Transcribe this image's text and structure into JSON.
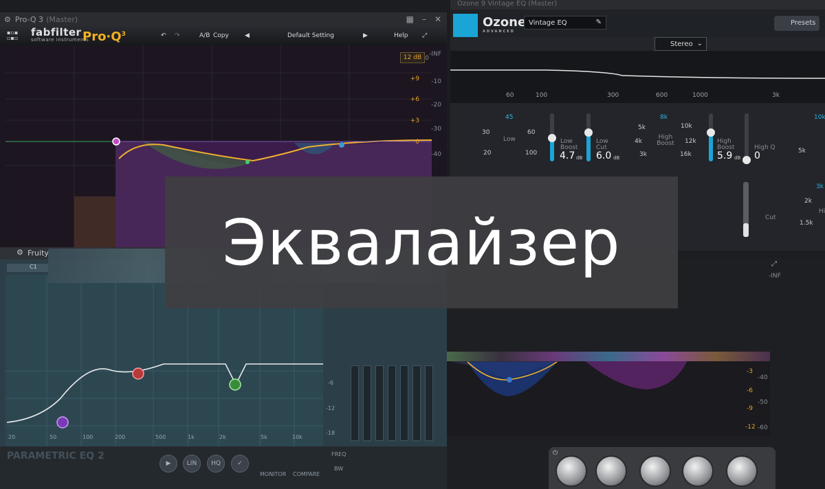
{
  "banner": {
    "title": "Эквалайзер"
  },
  "proq": {
    "window_title": "Pro-Q 3",
    "window_mode": "(Master)",
    "brand": "fabfilter",
    "brand_sub": "software instruments",
    "product": "Pro·Q",
    "ab": "A/B",
    "copy": "Copy",
    "preset": "Default Setting",
    "help": "Help",
    "range": "12 dB",
    "gain_ticks": [
      "+9",
      "+6",
      "+3",
      "0"
    ],
    "db_ticks": [
      "-INF",
      "0",
      "-10",
      "-20",
      "-30",
      "-40"
    ]
  },
  "ozone": {
    "window_title": "Ozone 9 Vintage EQ",
    "window_mode": "(Master)",
    "logo": "Ozone",
    "logo_sub": "ADVANCED",
    "preset": "Vintage EQ",
    "presets_button": "Presets",
    "stereo": "Stereo",
    "freq_labels": [
      "60",
      "100",
      "300",
      "600",
      "1000",
      "3k"
    ],
    "low_knob": {
      "label": "Low",
      "value": "45",
      "ticks": [
        "30",
        "60",
        "20",
        "100"
      ]
    },
    "low_boost": {
      "label": "Low Boost",
      "value": "4.7",
      "unit": "dB"
    },
    "low_cut": {
      "label": "Low Cut",
      "value": "6.0",
      "unit": "dB"
    },
    "high_knob": {
      "label": "High Boost",
      "value": "8k",
      "ticks": [
        "5k",
        "10k",
        "4k",
        "12k",
        "3k",
        "16k"
      ]
    },
    "high_boost": {
      "label": "High Boost",
      "value": "5.9",
      "unit": "dB"
    },
    "high_q": {
      "label": "High Q",
      "value": "0"
    },
    "right_knob": {
      "value": "10k",
      "ticks": [
        "5k"
      ]
    },
    "right_knob2": {
      "value": "3k",
      "label": "High",
      "ticks": [
        "2k",
        "1.5k"
      ]
    },
    "cut_label": "Cut"
  },
  "fruity": {
    "window_title": "Fruity",
    "band": "C1",
    "name": "PARAMETRIC EQ 2",
    "freq_ticks": [
      "20",
      "50",
      "100",
      "200",
      "500",
      "1k",
      "2k",
      "5k",
      "10k"
    ],
    "db_ticks": [
      "-6",
      "-12",
      "-18"
    ],
    "buttons": {
      "lin": "LIN",
      "hq": "HQ",
      "monitor": "MONITOR",
      "compare": "COMPARE"
    },
    "row_labels": {
      "freq": "FREQ",
      "bw": "BW"
    }
  },
  "lower_right": {
    "gain_ticks": [
      "-3",
      "-6",
      "-9",
      "-12"
    ],
    "db_ticks": [
      "-40",
      "-50",
      "-60",
      "-INF"
    ]
  }
}
